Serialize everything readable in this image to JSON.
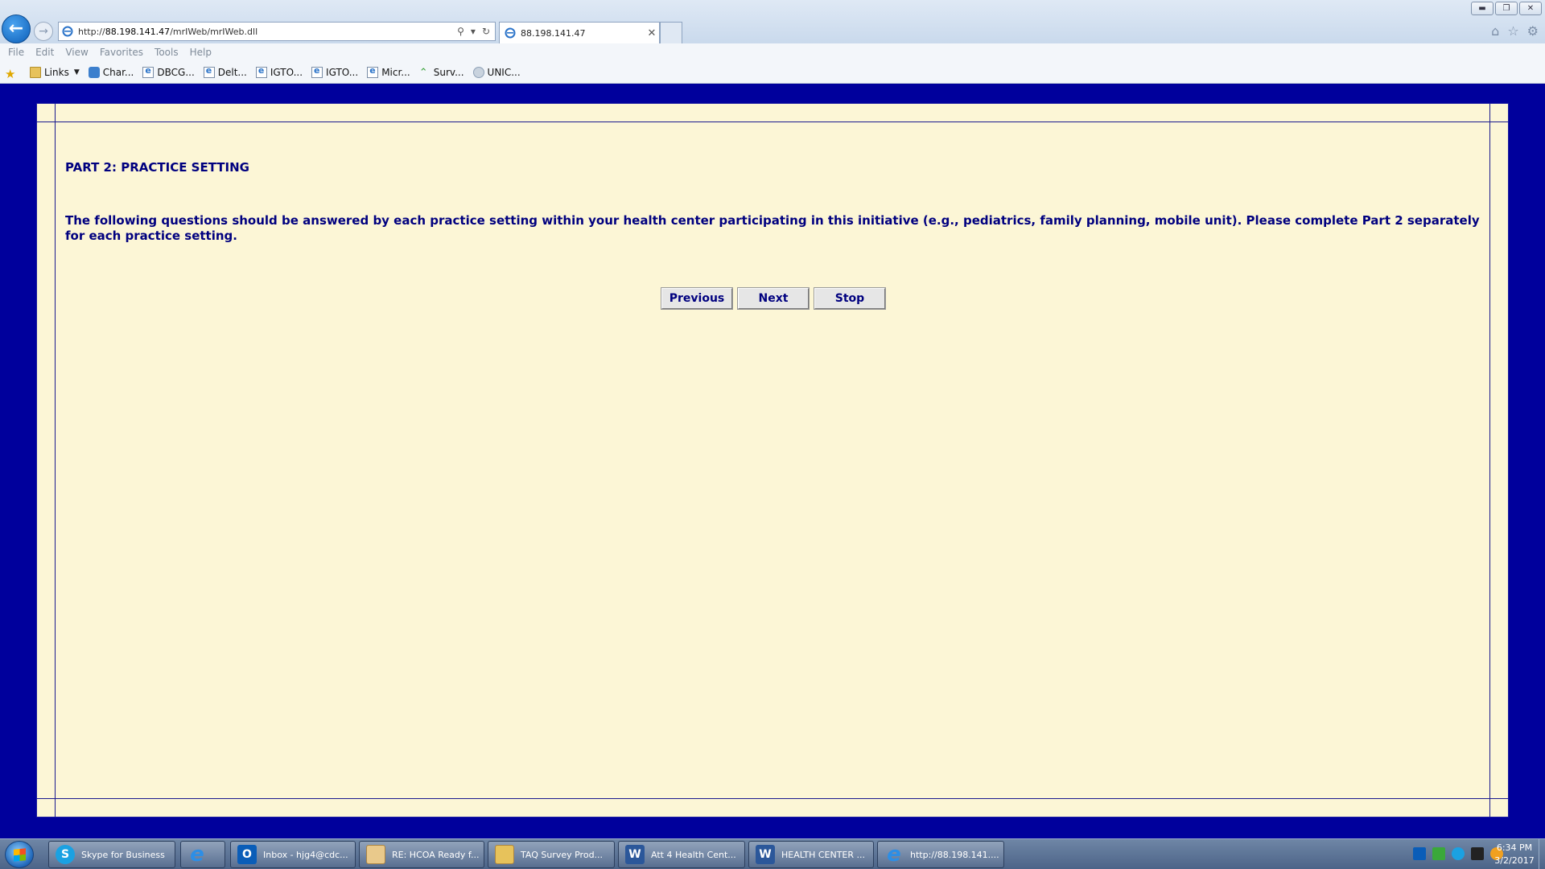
{
  "browser": {
    "url_prefix": "http://",
    "url_host": "88.198.141.47",
    "url_path": "/mrIWeb/mrIWeb.dll",
    "tab_title": "88.198.141.47",
    "menu": [
      "File",
      "Edit",
      "View",
      "Favorites",
      "Tools",
      "Help"
    ],
    "favorites": [
      {
        "label": "Links",
        "icon": "folder-icon"
      },
      {
        "label": "Char...",
        "icon": "page-icon"
      },
      {
        "label": "DBCG...",
        "icon": "page-icon"
      },
      {
        "label": "Delt...",
        "icon": "page-icon"
      },
      {
        "label": "IGTO...",
        "icon": "page-icon"
      },
      {
        "label": "IGTO...",
        "icon": "page-icon"
      },
      {
        "label": "Micr...",
        "icon": "page-icon"
      },
      {
        "label": "Surv...",
        "icon": "survey-icon"
      },
      {
        "label": "UNIC...",
        "icon": "globe-icon"
      }
    ]
  },
  "survey": {
    "part_title": "PART 2: PRACTICE SETTING",
    "instructions": "The following questions should be answered by each practice setting within your health center participating in this initiative (e.g., pediatrics, family planning, mobile unit). Please complete Part 2 separately for each practice setting.",
    "buttons": {
      "previous": "Previous",
      "next": "Next",
      "stop": "Stop"
    }
  },
  "taskbar": {
    "items": [
      {
        "label": "Skype for Business",
        "icon": "skype-icon"
      },
      {
        "label": "",
        "icon": "internet-explorer-icon"
      },
      {
        "label": "Inbox - hjg4@cdc...",
        "icon": "outlook-icon"
      },
      {
        "label": "RE: HCOA Ready f...",
        "icon": "mail-icon"
      },
      {
        "label": "TAQ Survey Prod...",
        "icon": "folder-icon"
      },
      {
        "label": "Att 4 Health Cent...",
        "icon": "word-icon"
      },
      {
        "label": "HEALTH CENTER ...",
        "icon": "word-icon"
      },
      {
        "label": "http://88.198.141....",
        "icon": "internet-explorer-icon"
      }
    ],
    "clock_time": "6:34 PM",
    "clock_date": "3/2/2017"
  },
  "colors": {
    "page_background": "#00009c",
    "content_background": "#fcf6d6",
    "text": "#00007f"
  }
}
